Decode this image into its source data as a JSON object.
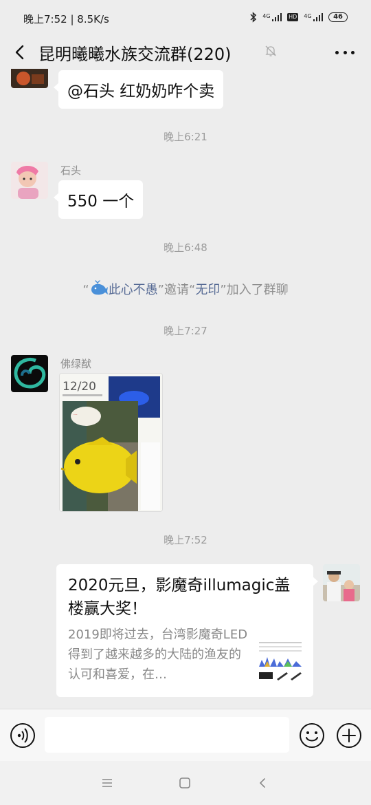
{
  "status": {
    "time": "晚上7:52",
    "net_speed": "8.5K/s",
    "net_a": "4G",
    "net_b": "4G",
    "hd": "HD",
    "battery": "46"
  },
  "header": {
    "title": "昆明曦曦水族交流群(220)"
  },
  "messages": {
    "m1_text": "@石头  红奶奶咋个卖",
    "t1": "晚上6:21",
    "m2_sender": "石头",
    "m2_text": "550 一个",
    "t2": "晚上6:48",
    "sys_q1": "“",
    "sys_inviter": "此心不愚",
    "sys_q2": "”邀请“",
    "sys_invitee": "无印",
    "sys_q3": "”加入了群聊",
    "t3": "晚上7:27",
    "m3_sender": "佛绿猷",
    "img_date": "12/20",
    "t4": "晚上7:52",
    "card_title": "2020元旦，影魔奇illumagic盖楼赢大奖！",
    "card_desc": "2019即将过去，台湾影魔奇LED得到了越来越多的大陆的渔友的认可和喜爱，在…"
  },
  "colors": {
    "background": "#ededed",
    "link": "#576b95",
    "bubble": "#ffffff",
    "timestamp": "#9b9b9b"
  },
  "icons": {
    "back": "chevron-left-icon",
    "mute": "bell-off-icon",
    "more": "ellipsis-icon",
    "voice": "voice-icon",
    "emoji": "smiley-icon",
    "plus": "plus-icon",
    "whale": "whale-icon"
  }
}
